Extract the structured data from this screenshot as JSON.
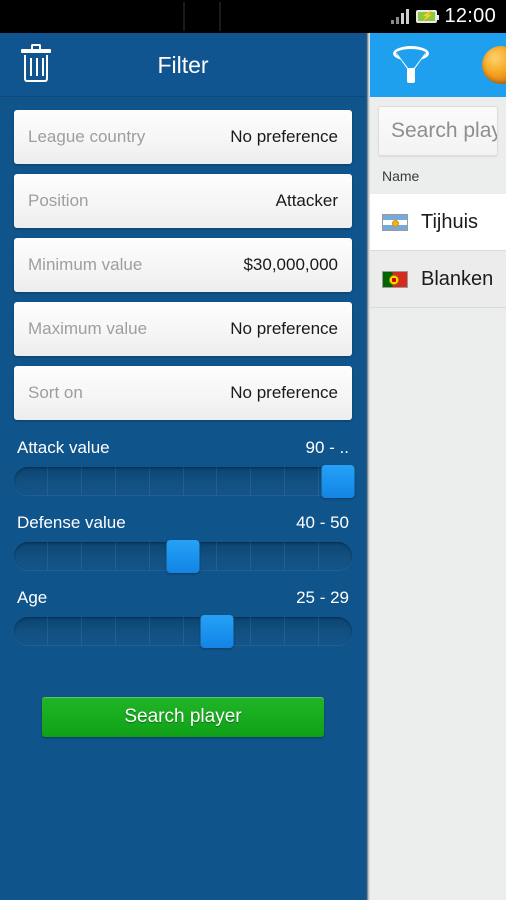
{
  "statusbar": {
    "time": "12:00",
    "battery_icon": "battery-charging-icon",
    "signal_icon": "signal-bars-icon"
  },
  "left_panel": {
    "actionbar": {
      "delete_icon": "trash-icon",
      "title": "Filter"
    },
    "fields": [
      {
        "label": "League country",
        "value": "No preference"
      },
      {
        "label": "Position",
        "value": "Attacker"
      },
      {
        "label": "Minimum value",
        "value": "$30,000,000"
      },
      {
        "label": "Maximum value",
        "value": "No preference"
      },
      {
        "label": "Sort on",
        "value": "No preference"
      }
    ],
    "sliders": [
      {
        "label": "Attack value",
        "value": "90 - ..",
        "position": 96
      },
      {
        "label": "Defense value",
        "value": "40 - 50",
        "position": 50
      },
      {
        "label": "Age",
        "value": "25 - 29",
        "position": 60
      }
    ],
    "search_button": "Search player"
  },
  "right_panel": {
    "actionbar": {
      "filter_icon": "funnel-icon",
      "secondary_icon": "orange-ball-icon"
    },
    "search": {
      "placeholder": "Search play"
    },
    "column_header": "Name",
    "rows": [
      {
        "name": "Tijhuis",
        "flag": "argentina-flag"
      },
      {
        "name": "Blanken",
        "flag": "portugal-flag"
      }
    ]
  },
  "colors": {
    "panel_blue": "#10548c",
    "actionbar_blue": "#115590",
    "accent_blue": "#1fa0ef",
    "button_green": "#18ac1f",
    "list_bg": "#eceded"
  }
}
